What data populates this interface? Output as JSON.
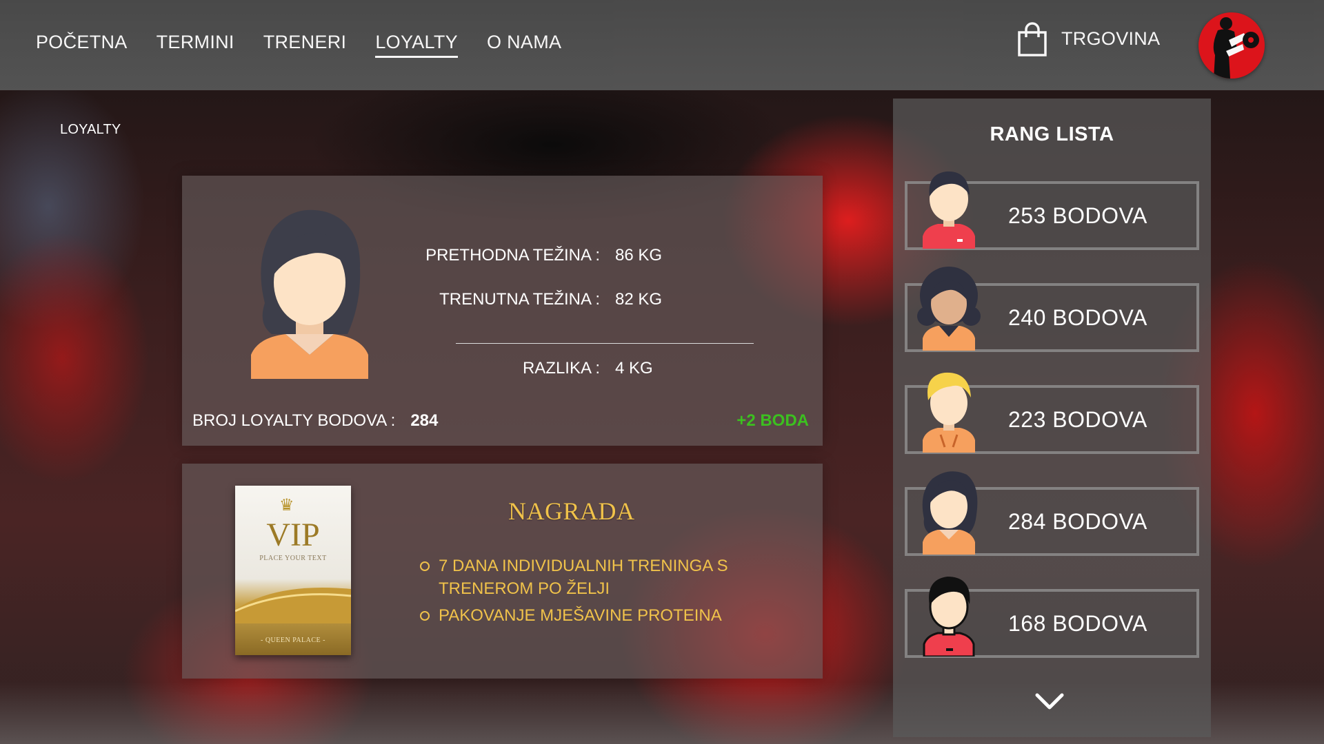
{
  "nav": {
    "items": [
      {
        "label": "POČETNA"
      },
      {
        "label": "TERMINI"
      },
      {
        "label": "TRENERI"
      },
      {
        "label": "LOYALTY"
      },
      {
        "label": "O NAMA"
      }
    ],
    "shop_label": "TRGOVINA"
  },
  "breadcrumb": "LOYALTY",
  "stats": {
    "previous_label": "PRETHODNA TEŽINA :",
    "previous_value": "86 KG",
    "current_label": "TRENUTNA TEŽINA :",
    "current_value": "82 KG",
    "diff_label": "RAZLIKA :",
    "diff_value": "4 KG",
    "points_label": "BROJ LOYALTY BODOVA :",
    "points_value": "284",
    "bonus": "+2 BODA"
  },
  "reward": {
    "vip_title": "VIP",
    "vip_sub": "PLACE YOUR TEXT",
    "vip_foot": "- QUEEN PALACE -",
    "title": "NAGRADA",
    "items": [
      {
        "text": "7 DANA INDIVIDUALNIH TRENINGA S TRENEROM PO ŽELJI"
      },
      {
        "text": "PAKOVANJE MJEŠAVINE PROTEINA"
      }
    ]
  },
  "ranking": {
    "title": "RANG LISTA",
    "entries": [
      {
        "points": "253 BODOVA",
        "avatar": "male-avatar-short-hair"
      },
      {
        "points": "240 BODOVA",
        "avatar": "female-avatar-curly-hair"
      },
      {
        "points": "223 BODOVA",
        "avatar": "blond-avatar"
      },
      {
        "points": "284 BODOVA",
        "avatar": "female-avatar-dark-hair"
      },
      {
        "points": "168 BODOVA",
        "avatar": "male-avatar-outline"
      }
    ]
  },
  "colors": {
    "accent_gold": "#f0c24a",
    "bonus_green": "#3cc020",
    "brand_red": "#e3141c"
  }
}
